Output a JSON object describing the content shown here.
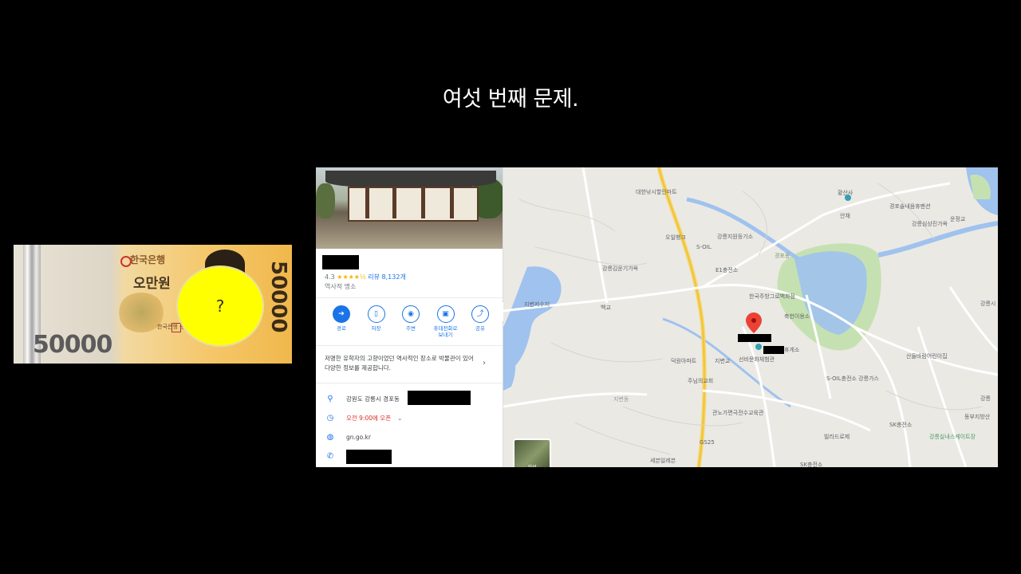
{
  "slide_title": "여섯 번째 문제.",
  "banknote": {
    "bank_name": "한국은행",
    "denomination_text": "오만원",
    "denomination_big": "50000",
    "denomination_side": "50000",
    "governor_text": "한국은행 총재",
    "cover_mark": "?"
  },
  "place_panel": {
    "rating": "4.3",
    "stars": "★★★★½",
    "reviews": "리뷰 8,132개",
    "category": "역사적 명소",
    "actions": [
      {
        "icon": "directions-icon",
        "glyph": "➔",
        "label": "경로"
      },
      {
        "icon": "bookmark-icon",
        "glyph": "▯",
        "label": "저장"
      },
      {
        "icon": "nearby-icon",
        "glyph": "◉",
        "label": "주변"
      },
      {
        "icon": "send-to-phone-icon",
        "glyph": "▣",
        "label": "휴대전화로 보내기"
      },
      {
        "icon": "share-icon",
        "glyph": "⤴",
        "label": "공유"
      }
    ],
    "description": "저명한 유학자의 고향이었던 역사적인 장소로 박물관이 있어 다양한 정보를 제공합니다.",
    "address": "강원도 강릉시 경포동",
    "hours_status": "오전 9:00에 오픈",
    "website": "gn.go.kr",
    "collapse_glyph": "◂"
  },
  "map": {
    "labels": [
      "대한낚시할인마트",
      "황산사",
      "안채",
      "경포솔내음휴팬션",
      "강릉심상진가옥",
      "운정교",
      "오일뱅크",
      "강릉지원등기소",
      "S-OIL",
      "경포동",
      "강릉김윤기가옥",
      "E1충전소",
      "지변저수지",
      "백교",
      "한국주방그로백화점",
      "축헌이용소",
      "휴게소",
      "덕원아파트",
      "지변교",
      "선비문화체험관",
      "산들바람어린이집",
      "주님의교회",
      "S-OIL충전소 강릉가스",
      "지변동",
      "관노가면극전수교육관",
      "SK충전소",
      "빌라드로제",
      "GS25",
      "세븐일레븐",
      "강릉실내스케이트장",
      "동부지방산",
      "강릉시",
      "강릉",
      "SK충전소"
    ],
    "satellite_label": "위성"
  },
  "colors": {
    "accent": "#1a73e8",
    "cover": "#ffff00",
    "pin": "#ea4335",
    "water": "#9fc2ee",
    "park": "#c6e1b1",
    "road_major": "#f7d35c"
  }
}
